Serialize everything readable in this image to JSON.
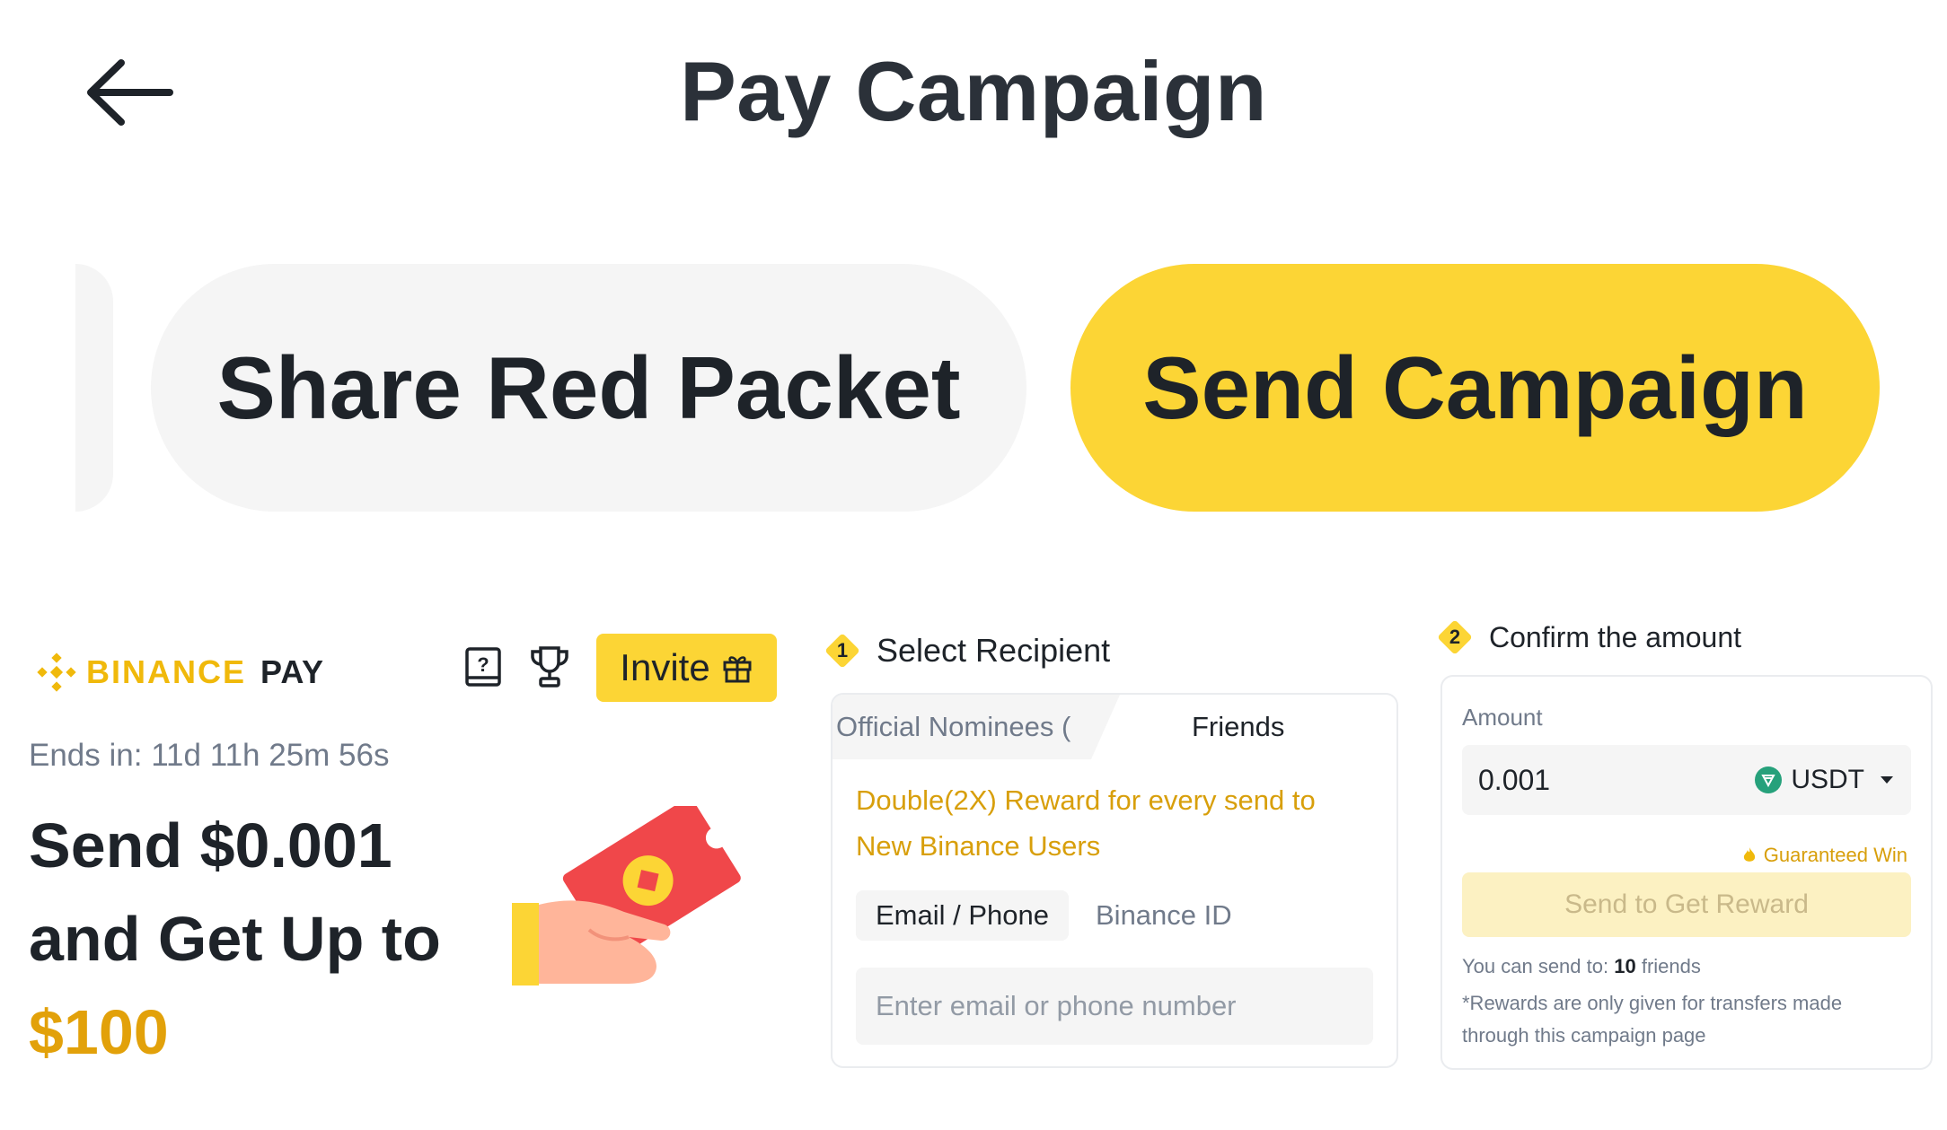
{
  "header": {
    "title": "Pay Campaign",
    "back_icon": "arrow-left-icon"
  },
  "big_tabs": [
    {
      "label": "Share Red Packet",
      "active": false
    },
    {
      "label": "Send Campaign",
      "active": true
    }
  ],
  "promo": {
    "brand_name": "BINANCE",
    "brand_suffix": "PAY",
    "invite_label": "Invite",
    "ends_in": "Ends in: 11d 11h 25m 56s",
    "headline_line1": "Send $0.001",
    "headline_line2": "and Get Up to",
    "headline_amount": "$100",
    "colors": {
      "accent": "#fcd535",
      "gold_text": "#e2a10a",
      "red_packet": "#f0474a"
    }
  },
  "step1": {
    "number": "1",
    "title": "Select Recipient",
    "tabs": [
      {
        "label": "Official Nominees (",
        "active": false
      },
      {
        "label": "Friends",
        "active": true
      }
    ],
    "promo_text": "Double(2X) Reward for every send to New Binance Users",
    "methods": [
      {
        "label": "Email / Phone",
        "active": true
      },
      {
        "label": "Binance ID",
        "active": false
      }
    ],
    "input_placeholder": "Enter email or phone number"
  },
  "step2": {
    "number": "2",
    "title": "Confirm the amount",
    "amount_label": "Amount",
    "amount_value": "0.001",
    "currency": "USDT",
    "guaranteed_label": "Guaranteed Win",
    "send_button": "Send to Get Reward",
    "can_send_prefix": "You can send to:",
    "can_send_count": "10",
    "can_send_suffix": "friends",
    "note": "*Rewards are only given for transfers made through this campaign page"
  }
}
